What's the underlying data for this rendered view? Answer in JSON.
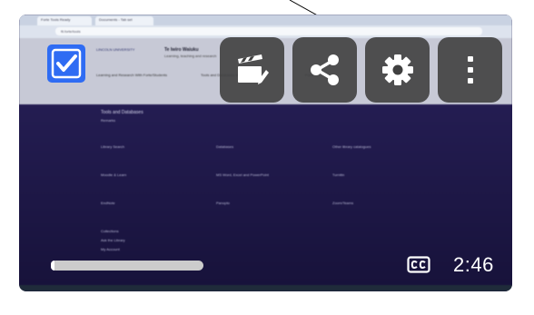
{
  "browser": {
    "tabs": [
      "Forte Tools Ready",
      "Documents - Tab set"
    ],
    "address": "fil.forte/tools"
  },
  "site": {
    "logo_text": "LINCOLN UNIVERSITY",
    "title": "Te Iwiro Waiuku",
    "subtitle": "Learning, teaching and research",
    "nav": [
      "Learning and Research With Forte/Students",
      "Tools and Databases Students",
      "Forte"
    ],
    "section_title": "Tools and Databases",
    "section_subtitle": "Remarks",
    "links": [
      [
        "Library Search",
        "Databases",
        "Other library catalogues"
      ],
      [
        "Moodle & Learn",
        "MS Word, Excel and PowerPoint",
        "Turnitin"
      ],
      [
        "EndNote",
        "Panopto",
        "Zoom/Teams"
      ],
      [
        "Collections",
        "",
        ""
      ],
      [
        "Ask the Library",
        "",
        ""
      ],
      [
        "My Account",
        "",
        ""
      ]
    ]
  },
  "player": {
    "controls": {
      "clapper": "clapperboard-icon",
      "share": "share-icon",
      "settings": "settings-gear-icon",
      "more": "more-vertical-icon"
    },
    "captions": "closed-captions-icon",
    "time": "2:46",
    "progress_fraction": 0.02,
    "accent": "#2f6cf3"
  }
}
